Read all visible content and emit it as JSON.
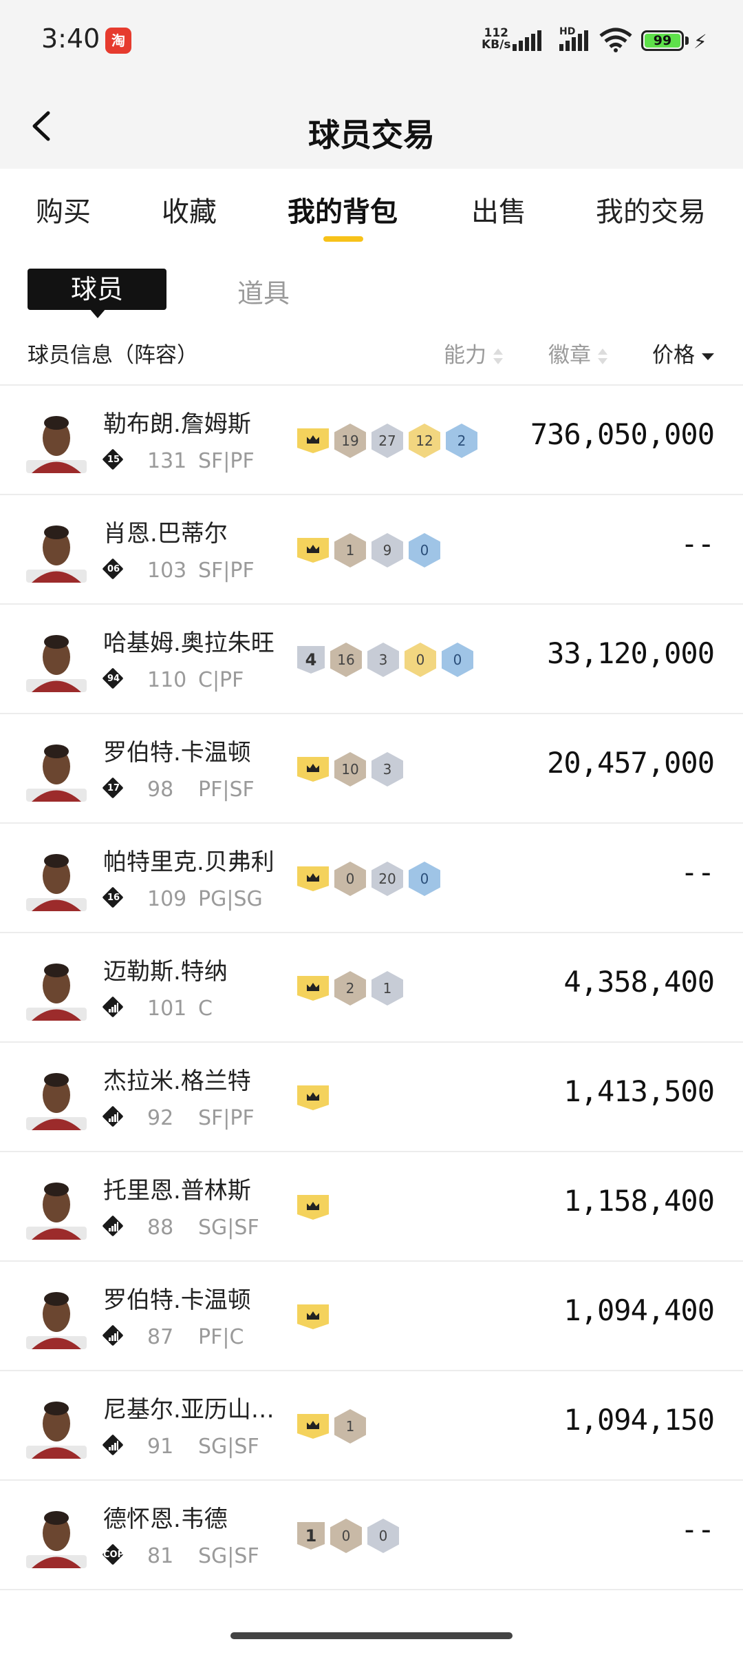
{
  "status_bar": {
    "time": "3:40",
    "app_badge": "淘",
    "net_speed_value": "112",
    "net_speed_unit": "KB/s",
    "hd_label": "HD",
    "battery": "99"
  },
  "header": {
    "title": "球员交易"
  },
  "tabs": [
    "购买",
    "收藏",
    "我的背包",
    "出售",
    "我的交易"
  ],
  "active_tab_index": 2,
  "subtabs": {
    "active": "球员",
    "other": "道具"
  },
  "columns": {
    "info": "球员信息（阵容）",
    "ability": "能力",
    "badges": "徽章",
    "price": "价格"
  },
  "players": [
    {
      "name": "勒布朗.詹姆斯",
      "icon_num": "15",
      "ovr": "131",
      "pos": "SF|PF",
      "price": "736,050,000",
      "rank": "",
      "badges": [
        [
          "19",
          "g"
        ],
        [
          "27",
          "s"
        ],
        [
          "12",
          "y"
        ],
        [
          "2",
          "b"
        ]
      ]
    },
    {
      "name": "肖恩.巴蒂尔",
      "icon_num": "06",
      "ovr": "103",
      "pos": "SF|PF",
      "price": "--",
      "rank": "",
      "badges": [
        [
          "1",
          "g"
        ],
        [
          "9",
          "s"
        ],
        [
          "0",
          "b"
        ]
      ]
    },
    {
      "name": "哈基姆.奥拉朱旺",
      "icon_num": "94",
      "ovr": "110",
      "pos": "C|PF",
      "price": "33,120,000",
      "rank": "4",
      "badges": [
        [
          "16",
          "g"
        ],
        [
          "3",
          "s"
        ],
        [
          "0",
          "y"
        ],
        [
          "0",
          "b"
        ]
      ]
    },
    {
      "name": "罗伯特.卡温顿",
      "icon_num": "17",
      "ovr": "98",
      "pos": "PF|SF",
      "price": "20,457,000",
      "rank": "",
      "badges": [
        [
          "10",
          "g"
        ],
        [
          "3",
          "s"
        ]
      ]
    },
    {
      "name": "帕特里克.贝弗利",
      "icon_num": "16",
      "ovr": "109",
      "pos": "PG|SG",
      "price": "--",
      "rank": "",
      "badges": [
        [
          "0",
          "g"
        ],
        [
          "20",
          "s"
        ],
        [
          "0",
          "b"
        ]
      ]
    },
    {
      "name": "迈勒斯.特纳",
      "icon_num": "",
      "ovr": "101",
      "pos": "C",
      "price": "4,358,400",
      "rank": "",
      "badges": [
        [
          "2",
          "g"
        ],
        [
          "1",
          "s"
        ]
      ]
    },
    {
      "name": "杰拉米.格兰特",
      "icon_num": "",
      "ovr": "92",
      "pos": "SF|PF",
      "price": "1,413,500",
      "rank": "",
      "badges": []
    },
    {
      "name": "托里恩.普林斯",
      "icon_num": "",
      "ovr": "88",
      "pos": "SG|SF",
      "price": "1,158,400",
      "rank": "",
      "badges": []
    },
    {
      "name": "罗伯特.卡温顿",
      "icon_num": "",
      "ovr": "87",
      "pos": "PF|C",
      "price": "1,094,400",
      "rank": "",
      "badges": []
    },
    {
      "name": "尼基尔.亚历山…",
      "icon_num": "",
      "ovr": "91",
      "pos": "SG|SF",
      "price": "1,094,150",
      "rank": "",
      "badges": [
        [
          "1",
          "g"
        ]
      ]
    },
    {
      "name": "德怀恩.韦德",
      "icon_num": "COPY",
      "ovr": "81",
      "pos": "SG|SF",
      "price": "--",
      "rank": "1",
      "badges": [
        [
          "0",
          "g"
        ],
        [
          "0",
          "s"
        ]
      ]
    }
  ]
}
